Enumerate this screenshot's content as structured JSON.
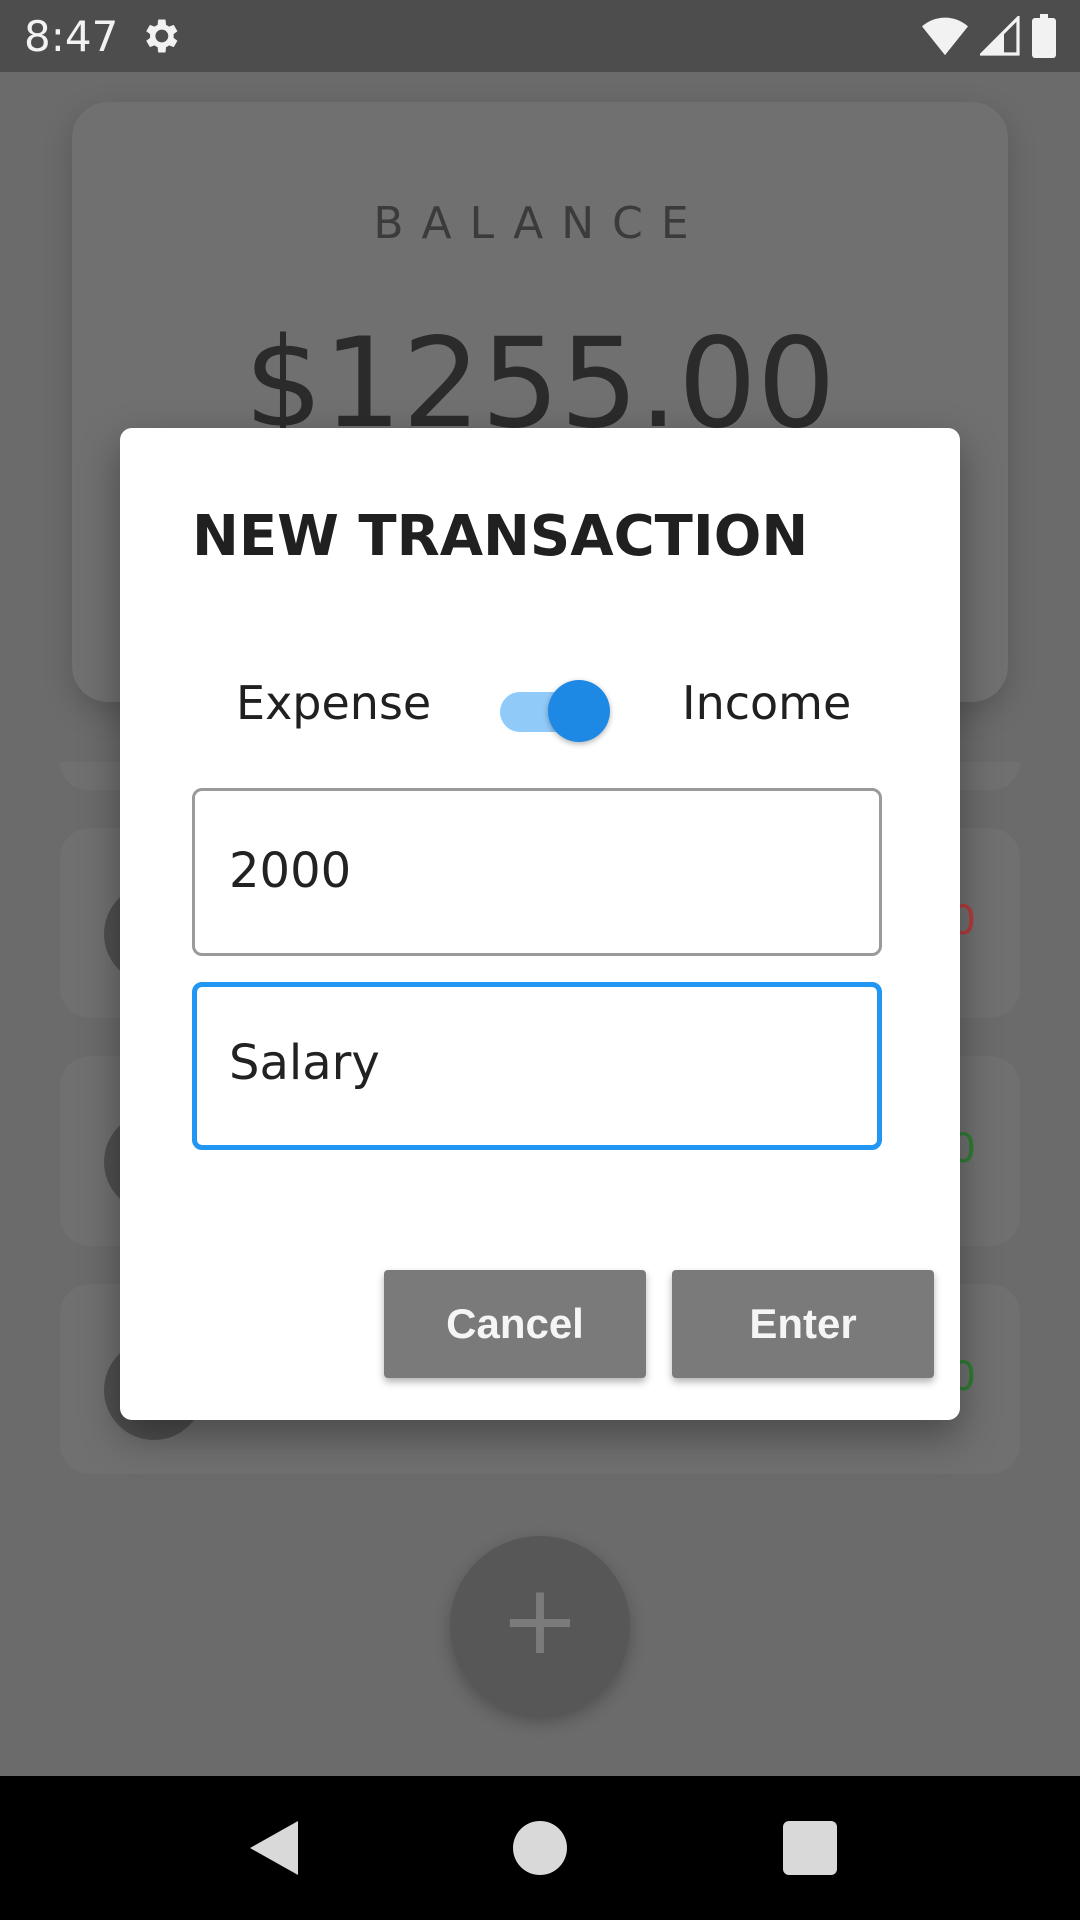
{
  "status_bar": {
    "time": "8:47",
    "icons": [
      "gear-icon",
      "wifi-icon",
      "signal-icon",
      "battery-icon"
    ]
  },
  "balance": {
    "label": "BALANCE",
    "amount": "$1255.00"
  },
  "transactions": [
    {
      "amount_color": "#c62828",
      "amount_fragment": "0"
    },
    {
      "amount_color": "#2e7d32",
      "amount_fragment": "0"
    },
    {
      "amount_color": "#2e7d32",
      "amount_fragment": "0"
    }
  ],
  "fab": {
    "label": "+"
  },
  "dialog": {
    "title": "NEW TRANSACTION",
    "toggle": {
      "left_label": "Expense",
      "right_label": "Income",
      "state": "income",
      "track_color": "#90caf9",
      "thumb_color": "#1e88e5"
    },
    "amount_field": {
      "value": "2000"
    },
    "description_field": {
      "value": "Salary",
      "focus_color": "#2196f3"
    },
    "cancel_label": "Cancel",
    "enter_label": "Enter"
  },
  "nav": {
    "icons": [
      "back-icon",
      "home-icon",
      "recents-icon"
    ]
  }
}
